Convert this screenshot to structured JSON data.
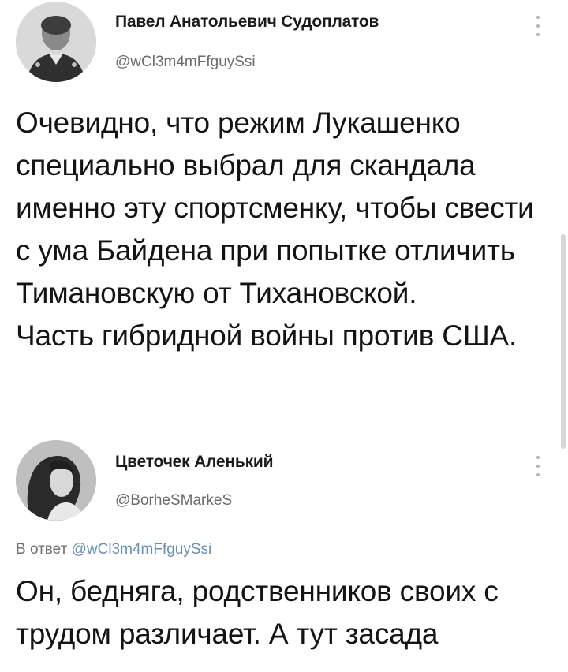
{
  "tweets": [
    {
      "author_name": "Павел Анатольевич Судоплатов",
      "author_handle": "@wCl3m4mFfguySsi",
      "avatar_icon": "avatar-man-uniform-photo",
      "body": "Очевидно, что режим Лукашенко специально выбрал для скандала именно эту спортсменку, чтобы свести с ума Байдена при попытке отличить Тимановскую от Тихановской.\nЧасть гибридной войны против США."
    },
    {
      "author_name": "Цветочек Аленький",
      "author_handle": "@BorheSMarkeS",
      "avatar_icon": "avatar-woman-photo",
      "reply_prefix": "В ответ",
      "reply_to_handle": "@wCl3m4mFfguySsi",
      "body": "Он, бедняга, родственников своих с трудом различает. А тут засада"
    }
  ],
  "colors": {
    "text": "#141414",
    "secondary": "#6b6b6b",
    "link": "#6a8fb5"
  }
}
